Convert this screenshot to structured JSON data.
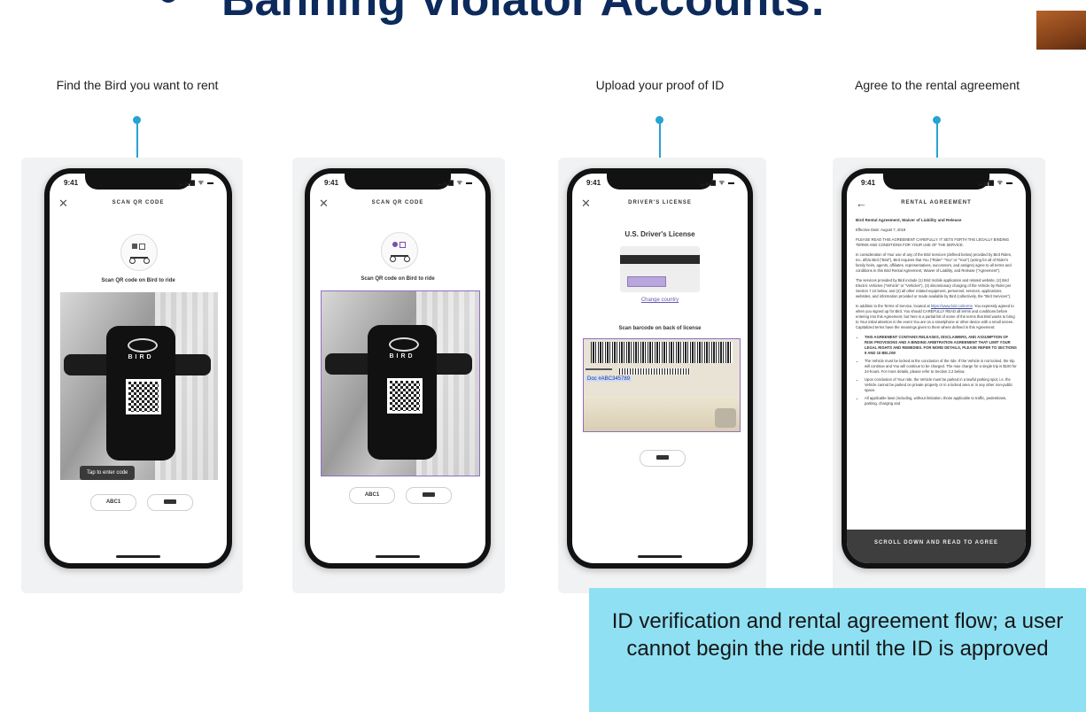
{
  "slide": {
    "title": "Banning Violator Accounts:"
  },
  "captions": {
    "step1": "Find the Bird you want to rent",
    "step3": "Upload your proof of ID",
    "step4": "Agree to the rental agreement"
  },
  "common": {
    "time": "9:41",
    "status_icons": "▂▄▆ ᯤ ▬"
  },
  "screen1": {
    "title": "SCAN QR CODE",
    "scan_text": "Scan QR code on Bird to ride",
    "device_brand": "BIRD",
    "tooltip": "Tap to enter code",
    "code_button": "ABC1"
  },
  "screen2": {
    "title": "SCAN QR CODE",
    "scan_text": "Scan QR code on Bird to ride",
    "device_brand": "BIRD",
    "code_button": "ABC1"
  },
  "screen3": {
    "title": "DRIVER'S LICENSE",
    "license_heading": "U.S. Driver's License",
    "change_country": "Change country",
    "scan_text": "Scan barcode on back of license",
    "doc_number": "Doc #ABC345789"
  },
  "screen4": {
    "title": "RENTAL AGREEMENT",
    "heading": "Bird Rental Agreement, Waiver of Liability and Release",
    "effective": "Effective Date: August 7, 2019",
    "p1": "PLEASE READ THIS AGREEMENT CAREFULLY. IT SETS FORTH THE LEGALLY BINDING TERMS AND CONDITIONS FOR YOUR USE OF THE SERVICE.",
    "p2": "In consideration of Your use of any of the Bird Services (defined below) provided by Bird Rides, Inc. d/b/a Bird (\"Bird\"), Bird requires that You (\"Rider\" \"You\" or \"Your\") (acting for all of Rider's family heirs, agents, affiliates, representatives, successors, and assigns) agree to all terms and conditions in this Bird Rental Agreement, Waiver of Liability, and Release (\"Agreement\").",
    "p3": "The services provided by Bird include (1) Bird mobile application and related website, (2) Bird Electric Vehicles (\"Vehicle\" or \"Vehicles\"), (3) discretionary charging of the Vehicle by Rider per Section 7.10 below, and (4) all other related equipment, personnel, services, applications, websites, and information provided or made available by Bird (collectively, the \"Bird Services\").",
    "p4_pre": "In addition to the Terms of Service, located at ",
    "p4_link": "https://www.bird.co/terms",
    "p4_post": ". You expressly agreed to when you signed up for Bird. You should CAREFULLY READ all terms and conditions before entering into this Agreement, but here is a partial list of some of the terms that Bird wants to bring to Your initial attention in the event You are on a smartphone or other device with a small screen. Capitalized terms have the meanings given to them where defined in this Agreement:",
    "li1": "THIS AGREEMENT CONTAINS RELEASES, DISCLAIMERS, AND ASSUMPTION OF RISK PROVISIONS AND A BINDING ARBITRATION AGREEMENT THAT LIMIT YOUR LEGAL RIGHTS AND REMEDIES. FOR MORE DETAILS, PLEASE REFER TO SECTIONS 9 AND 10 BELOW",
    "li2": "The Vehicle must be locked at the conclusion of the ride. If the Vehicle is not locked, the trip will continue and You will continue to be charged. The max charge for a single trip is $100 for 24-hours. For more details, please refer to Section 2.2 below.",
    "li3": "Upon conclusion of Your ride, the Vehicle must be parked in a lawful parking spot, i.e. the Vehicle cannot be parked on private property or in a locked area or in any other non-public space.",
    "li4": "All applicable laws (including, without limitation, those applicable to traffic, pedestrians, parking, charging and",
    "footer": "SCROLL DOWN AND READ TO AGREE"
  },
  "note": {
    "text": "ID verification and rental agreement flow; a user cannot begin the ride until the ID is approved"
  }
}
